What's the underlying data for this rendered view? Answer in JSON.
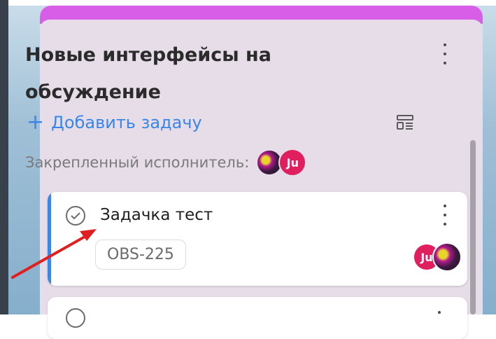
{
  "column": {
    "title": "Новые интерфейсы на обсуждение",
    "add_task_label": "Добавить задачу",
    "add_task_icon": "plus-icon",
    "menu_icon": "more-vertical-icon",
    "filter_icon": "layout-filter-icon",
    "assignee_label": "Закрепленный исполнитель:",
    "assignees": [
      {
        "type": "image",
        "name": "avatar"
      },
      {
        "type": "initials",
        "initials": "Ju"
      }
    ],
    "accent_color": "#d85ee8"
  },
  "card": {
    "title": "Задачка тест",
    "task_id": "OBS-225",
    "check_icon": "check-circle-icon",
    "menu_icon": "more-vertical-icon",
    "assignees": [
      {
        "type": "initials",
        "initials": "Ju"
      },
      {
        "type": "image",
        "name": "avatar"
      }
    ],
    "accent_color": "#3a86e8"
  },
  "colors": {
    "link": "#3a86e8",
    "avatar_ju": "#e01f5f",
    "annotation_arrow": "#e02020"
  }
}
